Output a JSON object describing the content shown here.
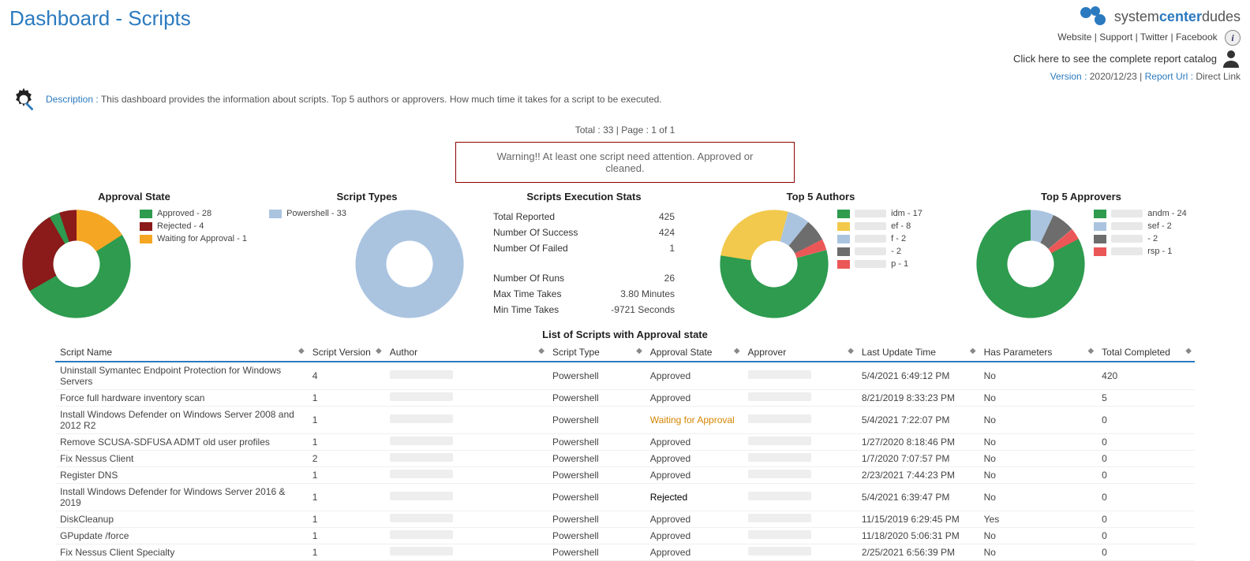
{
  "header": {
    "title": "Dashboard - Scripts",
    "description_label": "Description :",
    "description": "This dashboard provides the information about scripts. Top 5 authors or approvers. How much time it takes for a script to be executed.",
    "logo_text_1": "system",
    "logo_text_2": "center",
    "logo_text_3": "dudes",
    "links": {
      "website": "Website",
      "support": "Support",
      "twitter": "Twitter",
      "facebook": "Facebook"
    },
    "catalog": "Click here to see the complete report catalog",
    "version_label": "Version :",
    "version": "2020/12/23",
    "report_url_label": "Report Url :",
    "report_url": "Direct Link"
  },
  "pager": {
    "total_label": "Total :",
    "total": "33",
    "page_label": "Page :",
    "page": "1 of 1"
  },
  "warning": "Warning!! At least one script need attention. Approved or cleaned.",
  "approval_state": {
    "title": "Approval State",
    "items": [
      {
        "label": "Approved - 28",
        "color": "#2e9b4f"
      },
      {
        "label": "Rejected - 4",
        "color": "#8b1a1a"
      },
      {
        "label": "Waiting for Approval - 1",
        "color": "#f5a623"
      }
    ]
  },
  "script_types": {
    "title": "Script Types",
    "items": [
      {
        "label": "Powershell - 33",
        "color": "#aac4e0"
      }
    ]
  },
  "exec_stats": {
    "title": "Scripts Execution Stats",
    "rows1": [
      {
        "label": "Total Reported",
        "value": "425"
      },
      {
        "label": "Number Of Success",
        "value": "424"
      },
      {
        "label": "Number Of Failed",
        "value": "1"
      }
    ],
    "rows2": [
      {
        "label": "Number Of Runs",
        "value": "26"
      },
      {
        "label": "Max Time Takes",
        "value": "3.80  Minutes"
      },
      {
        "label": "Min Time Takes",
        "value": "-9721  Seconds"
      }
    ]
  },
  "top_authors": {
    "title": "Top 5 Authors",
    "items": [
      {
        "suffix": "idm - 17",
        "color": "#2e9b4f"
      },
      {
        "suffix": "ef - 8",
        "color": "#f2c94c"
      },
      {
        "suffix": "f - 2",
        "color": "#aac4e0"
      },
      {
        "suffix": "- 2",
        "color": "#6d6d6d"
      },
      {
        "suffix": "p - 1",
        "color": "#eb5757"
      }
    ]
  },
  "top_approvers": {
    "title": "Top 5 Approvers",
    "items": [
      {
        "suffix": "andm - 24",
        "color": "#2e9b4f"
      },
      {
        "suffix": "sef - 2",
        "color": "#aac4e0"
      },
      {
        "suffix": "- 2",
        "color": "#6d6d6d"
      },
      {
        "suffix": "rsp - 1",
        "color": "#eb5757"
      }
    ]
  },
  "table": {
    "title": "List of Scripts with Approval state",
    "headers": [
      "Script Name",
      "Script Version",
      "Author",
      "Script Type",
      "Approval State",
      "Approver",
      "Last Update Time",
      "Has Parameters",
      "Total Completed"
    ],
    "rows": [
      {
        "name": "Uninstall Symantec Endpoint Protection for Windows Servers",
        "version": "4",
        "type": "Powershell",
        "state": "Approved",
        "updated": "5/4/2021 6:49:12 PM",
        "params": "No",
        "completed": "420"
      },
      {
        "name": "Force full hardware inventory scan",
        "version": "1",
        "type": "Powershell",
        "state": "Approved",
        "updated": "8/21/2019 8:33:23 PM",
        "params": "No",
        "completed": "5"
      },
      {
        "name": "Install Windows Defender on Windows Server 2008 and 2012 R2",
        "version": "1",
        "type": "Powershell",
        "state": "Waiting for Approval",
        "state_class": "waiting",
        "updated": "5/4/2021 7:22:07 PM",
        "params": "No",
        "completed": "0"
      },
      {
        "name": "Remove SCUSA-SDFUSA ADMT old user profiles",
        "version": "1",
        "type": "Powershell",
        "state": "Approved",
        "updated": "1/27/2020 8:18:46 PM",
        "params": "No",
        "completed": "0"
      },
      {
        "name": "Fix Nessus Client",
        "version": "2",
        "type": "Powershell",
        "state": "Approved",
        "updated": "1/7/2020 7:07:57 PM",
        "params": "No",
        "completed": "0"
      },
      {
        "name": "Register DNS",
        "version": "1",
        "type": "Powershell",
        "state": "Approved",
        "updated": "2/23/2021 7:44:23 PM",
        "params": "No",
        "completed": "0"
      },
      {
        "name": "Install Windows Defender for Windows Server 2016 & 2019",
        "version": "1",
        "type": "Powershell",
        "state": "Rejected",
        "state_class": "rejected",
        "updated": "5/4/2021 6:39:47 PM",
        "params": "No",
        "completed": "0"
      },
      {
        "name": "DiskCleanup",
        "version": "1",
        "type": "Powershell",
        "state": "Approved",
        "updated": "11/15/2019 6:29:45 PM",
        "params": "Yes",
        "completed": "0"
      },
      {
        "name": "GPupdate /force",
        "version": "1",
        "type": "Powershell",
        "state": "Approved",
        "updated": "11/18/2020 5:06:31 PM",
        "params": "No",
        "completed": "0"
      },
      {
        "name": "Fix Nessus Client Specialty",
        "version": "1",
        "type": "Powershell",
        "state": "Approved",
        "updated": "2/25/2021 6:56:39 PM",
        "params": "No",
        "completed": "0"
      }
    ]
  },
  "chart_data": [
    {
      "type": "pie",
      "title": "Approval State",
      "series": [
        {
          "name": "Approval State",
          "values": [
            28,
            4,
            1
          ]
        }
      ],
      "categories": [
        "Approved",
        "Rejected",
        "Waiting for Approval"
      ]
    },
    {
      "type": "pie",
      "title": "Script Types",
      "series": [
        {
          "name": "Script Types",
          "values": [
            33
          ]
        }
      ],
      "categories": [
        "Powershell"
      ]
    },
    {
      "type": "table",
      "title": "Scripts Execution Stats",
      "rows": [
        [
          "Total Reported",
          425
        ],
        [
          "Number Of Success",
          424
        ],
        [
          "Number Of Failed",
          1
        ],
        [
          "Number Of Runs",
          26
        ],
        [
          "Max Time Takes (Minutes)",
          3.8
        ],
        [
          "Min Time Takes (Seconds)",
          -9721
        ]
      ]
    },
    {
      "type": "pie",
      "title": "Top 5 Authors",
      "series": [
        {
          "name": "Authors",
          "values": [
            17,
            8,
            2,
            2,
            1
          ]
        }
      ],
      "categories": [
        "(redacted) idm",
        "(redacted) ef",
        "(redacted) f",
        "(redacted)",
        "(redacted) p"
      ]
    },
    {
      "type": "pie",
      "title": "Top 5 Approvers",
      "series": [
        {
          "name": "Approvers",
          "values": [
            24,
            2,
            2,
            1
          ]
        }
      ],
      "categories": [
        "(redacted) andm",
        "(redacted) sef",
        "(redacted)",
        "(redacted) rsp"
      ]
    }
  ]
}
